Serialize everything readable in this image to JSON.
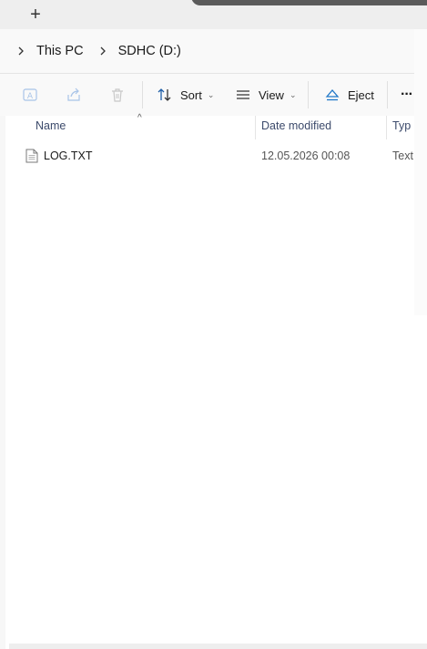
{
  "tabstrip": {
    "new_tab_icon": "+"
  },
  "breadcrumb": {
    "items": [
      "This PC",
      "SDHC (D:)"
    ]
  },
  "commandbar": {
    "sort_label": "Sort",
    "view_label": "View",
    "eject_label": "Eject",
    "more_icon": "···"
  },
  "columns": {
    "name": "Name",
    "date_modified": "Date modified",
    "type": "Typ"
  },
  "files": [
    {
      "name": "LOG.TXT",
      "date": "12.05.2026 00:08",
      "type": "Text"
    }
  ]
}
